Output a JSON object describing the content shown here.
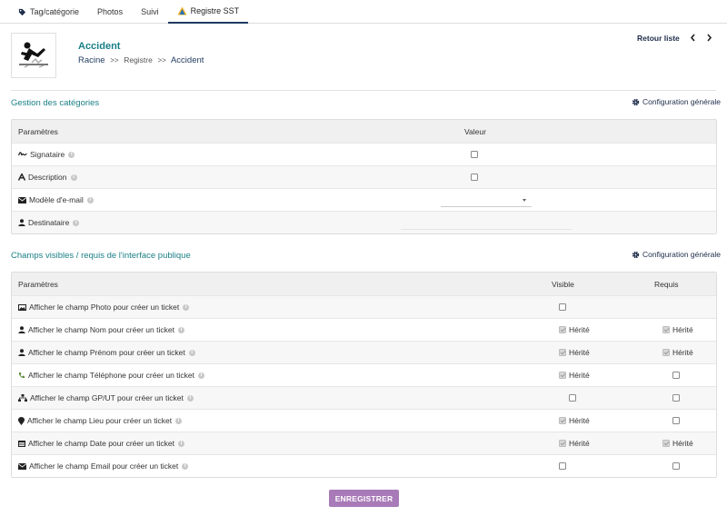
{
  "tabs": [
    {
      "label": "Tag/catégorie",
      "icon": "tag-icon",
      "active": false
    },
    {
      "label": "Photos",
      "active": false
    },
    {
      "label": "Suivi",
      "active": false
    },
    {
      "label": "Registre SST",
      "icon": "warning-triangle-icon",
      "active": true
    }
  ],
  "header": {
    "title": "Accident",
    "breadcrumb": [
      "Racine",
      "Registre",
      "Accident"
    ],
    "breadcrumb_sep": ">>",
    "back_label": "Retour liste"
  },
  "categories_section": {
    "title": "Gestion des catégories",
    "config_label": "Configuration générale",
    "col_params": "Paramètres",
    "col_value": "Valeur",
    "rows": [
      {
        "label": "Signataire",
        "icon": "signature-icon",
        "control": "checkbox",
        "checked": false
      },
      {
        "label": "Description",
        "icon": "font-icon",
        "control": "checkbox",
        "checked": false
      },
      {
        "label": "Modèle d'e-mail",
        "icon": "envelope-icon",
        "control": "select",
        "value": ""
      },
      {
        "label": "Destinataire",
        "icon": "user-icon",
        "control": "text",
        "value": ""
      }
    ]
  },
  "public_section": {
    "title": "Champs visibles / requis de l'interface publique",
    "config_label": "Configuration générale",
    "col_params": "Paramètres",
    "col_visible": "Visible",
    "col_required": "Requis",
    "inherited_label": "Hérité",
    "rows": [
      {
        "label": "Afficher le champ Photo pour créer un ticket",
        "icon": "image-icon",
        "visible": {
          "checked": false,
          "inherited": false
        },
        "required": null
      },
      {
        "label": "Afficher le champ Nom pour créer un ticket",
        "icon": "user-icon",
        "visible": {
          "checked": true,
          "inherited": true
        },
        "required": {
          "checked": true,
          "inherited": true
        }
      },
      {
        "label": "Afficher le champ Prénom pour créer un ticket",
        "icon": "user-icon",
        "visible": {
          "checked": true,
          "inherited": true
        },
        "required": {
          "checked": true,
          "inherited": true
        }
      },
      {
        "label": "Afficher le champ Téléphone pour créer un ticket",
        "icon": "phone-icon",
        "visible": {
          "checked": true,
          "inherited": true
        },
        "required": {
          "checked": false,
          "inherited": false
        }
      },
      {
        "label": "Afficher le champ GP/UT pour créer un ticket",
        "icon": "sitemap-icon",
        "visible": {
          "checked": false,
          "inherited": false
        },
        "required": {
          "checked": false,
          "inherited": false
        }
      },
      {
        "label": "Afficher le champ Lieu pour créer un ticket",
        "icon": "map-marker-icon",
        "visible": {
          "checked": true,
          "inherited": true
        },
        "required": {
          "checked": false,
          "inherited": false
        }
      },
      {
        "label": "Afficher le champ Date pour créer un ticket",
        "icon": "calendar-icon",
        "visible": {
          "checked": true,
          "inherited": true
        },
        "required": {
          "checked": true,
          "inherited": true
        }
      },
      {
        "label": "Afficher le champ Email pour créer un ticket",
        "icon": "envelope-icon",
        "visible": {
          "checked": false,
          "inherited": false
        },
        "required": {
          "checked": false,
          "inherited": false
        }
      }
    ]
  },
  "save_label": "ENREGISTRER",
  "colors": {
    "accent_teal": "#1a7f86",
    "nav_dark": "#1f2d4a",
    "save_button": "#a87ab8",
    "active_tab_border": "#1f3a5f"
  }
}
